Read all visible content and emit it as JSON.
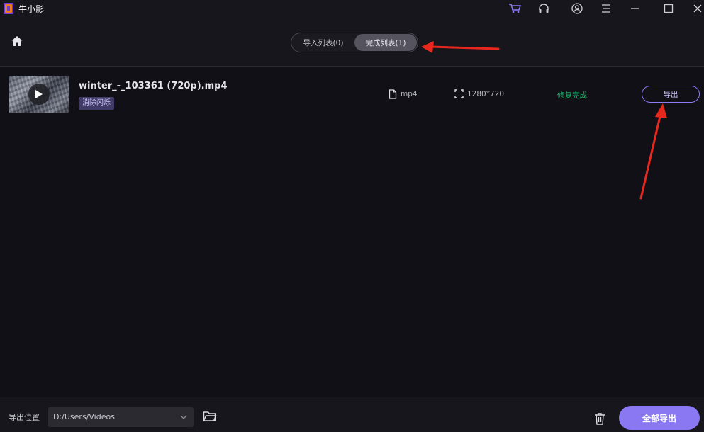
{
  "app": {
    "title": "牛小影"
  },
  "titlebar_icons": [
    "cart-icon",
    "headset-icon",
    "user-icon",
    "menu-icon",
    "minimize-icon",
    "maximize-icon",
    "close-icon"
  ],
  "tabs": [
    {
      "label": "导入列表(0)",
      "active": false
    },
    {
      "label": "完成列表(1)",
      "active": true
    }
  ],
  "file": {
    "name": "winter_-_103361 (720p).mp4",
    "tag": "消除闪烁",
    "format": "mp4",
    "resolution": "1280*720",
    "status": "修复完成",
    "export_label": "导出"
  },
  "footer": {
    "label": "导出位置",
    "path": "D:/Users/Videos",
    "export_all_label": "全部导出"
  },
  "colors": {
    "accent": "#8a78f2",
    "status_green": "#19b46a",
    "annotation_red": "#e8281e",
    "background": "#111016"
  }
}
